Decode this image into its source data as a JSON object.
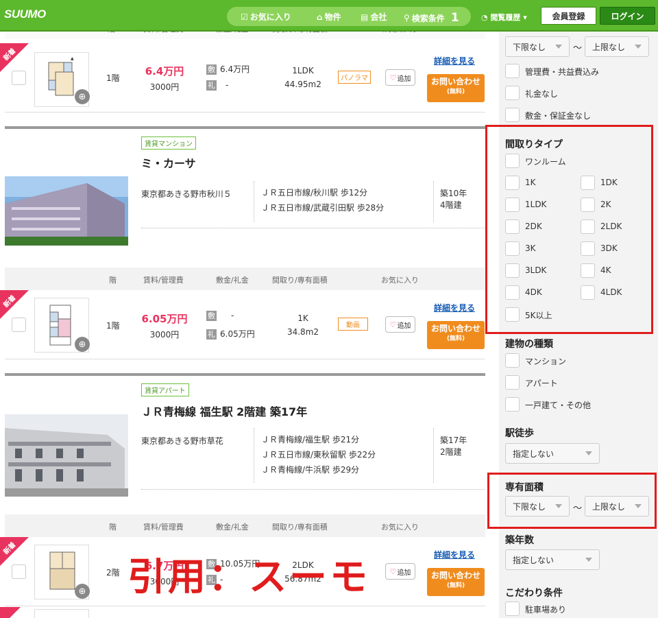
{
  "header": {
    "logo": "SUUMO",
    "nav": [
      {
        "label": "お気に入り",
        "icon": "checkbox-icon"
      },
      {
        "label": "物件",
        "icon": "house-icon"
      },
      {
        "label": "会社",
        "icon": "building-icon"
      },
      {
        "label": "検索条件",
        "icon": "search-icon",
        "count": "1"
      }
    ],
    "history": "閲覧履歴 ▾",
    "register": "会員登録",
    "login": "ログイン"
  },
  "table_header": {
    "floor": "階",
    "rent": "賃料/管理費",
    "deposit": "敷金/礼金",
    "layout": "間取り/専有面積",
    "favorite": "お気に入り"
  },
  "common": {
    "new_badge": "新着",
    "deposit_mark": "敷",
    "key_money_mark": "礼",
    "fav_label": "追加",
    "detail_label": "詳細を見る",
    "inquiry_label": "お問い合わせ",
    "inquiry_sub": "(無料)"
  },
  "rooms": [
    {
      "floor": "1階",
      "rent": "6.4万円",
      "mgmt": "3000円",
      "deposit": "6.4万円",
      "key_money": "-",
      "layout": "1LDK",
      "area": "44.95m2",
      "tag": "パノラマ"
    },
    {
      "floor": "1階",
      "rent": "6.05万円",
      "mgmt": "3000円",
      "deposit": "-",
      "key_money": "6.05万円",
      "layout": "1K",
      "area": "34.8m2",
      "tag": "動画"
    },
    {
      "floor": "2階",
      "rent": "6.7万円",
      "mgmt": "3000円",
      "deposit": "10.05万円",
      "key_money": "-",
      "layout": "2LDK",
      "area": "56.87m2",
      "tag": ""
    }
  ],
  "buildings": [
    {
      "category": "賃貸マンション",
      "name": "ミ・カーサ",
      "address": "東京都あきる野市秋川５",
      "access": [
        "ＪＲ五日市線/秋川駅 歩12分",
        "ＪＲ五日市線/武蔵引田駅 歩28分"
      ],
      "age": "築10年",
      "stories": "4階建"
    },
    {
      "category": "賃貸アパート",
      "name": "ＪＲ青梅線 福生駅 2階建 築17年",
      "address": "東京都あきる野市草花",
      "access": [
        "ＪＲ青梅線/福生駅 歩21分",
        "ＪＲ五日市線/東秋留駅 歩22分",
        "ＪＲ青梅線/牛浜駅 歩29分"
      ],
      "age": "築17年",
      "stories": "2階建"
    }
  ],
  "watermark": "引用：スーモ",
  "sidebar": {
    "rent_min": "下限なし",
    "rent_max": "上限なし",
    "tilde": "～",
    "price_options": [
      "管理費・共益費込み",
      "礼金なし",
      "敷金・保証金なし"
    ],
    "layout_title": "間取りタイプ",
    "layout_options": [
      "ワンルーム",
      "1K",
      "1DK",
      "1LDK",
      "2K",
      "2DK",
      "2LDK",
      "3K",
      "3DK",
      "3LDK",
      "4K",
      "4DK",
      "4LDK",
      "5K以上"
    ],
    "building_type_title": "建物の種類",
    "building_types": [
      "マンション",
      "アパート",
      "一戸建て・その他"
    ],
    "walk_title": "駅徒歩",
    "walk_value": "指定しない",
    "area_title": "専有面積",
    "area_min": "下限なし",
    "area_max": "上限なし",
    "age_title": "築年数",
    "age_value": "指定しない",
    "extra_title": "こだわり条件",
    "extra_options": [
      "駐車場あり"
    ]
  },
  "colors": {
    "header_green": "#5cb82c",
    "rent_pink": "#e8335e",
    "inquiry_orange": "#f08c1e",
    "highlight_red": "#e01c1c"
  }
}
